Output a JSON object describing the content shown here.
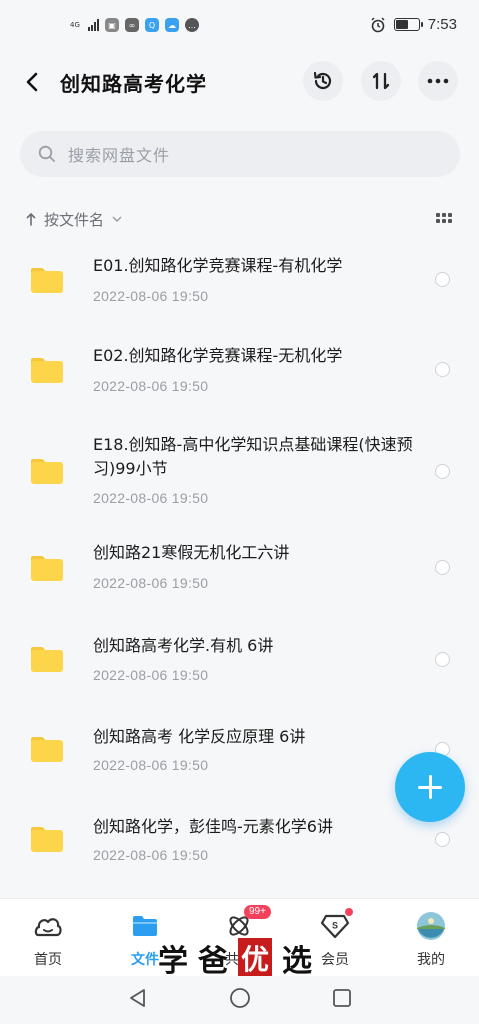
{
  "status_bar": {
    "network": "4G",
    "time": "7:53",
    "battery_level": 0.55
  },
  "header": {
    "title": "创知路高考化学",
    "back_icon": "chevron-left-icon",
    "history_icon": "history-icon",
    "sort_icon": "sort-icon",
    "more_icon": "more-icon"
  },
  "search": {
    "placeholder": "搜索网盘文件"
  },
  "sort": {
    "label": "按文件名"
  },
  "files": [
    {
      "name": "E01.创知路化学竞赛课程-有机化学",
      "date": "2022-08-06  19:50"
    },
    {
      "name": "E02.创知路化学竞赛课程-无机化学",
      "date": "2022-08-06  19:50"
    },
    {
      "name": "E18.创知路-高中化学知识点基础课程(快速预习)99小节",
      "date": "2022-08-06  19:50"
    },
    {
      "name": "创知路21寒假无机化工六讲",
      "date": "2022-08-06  19:50"
    },
    {
      "name": "创知路高考化学.有机   6讲",
      "date": "2022-08-06  19:50"
    },
    {
      "name": "创知路高考 化学反应原理   6讲",
      "date": "2022-08-06  19:50"
    },
    {
      "name": "创知路化学，彭佳鸣-元素化学6讲",
      "date": "2022-08-06  19:50"
    }
  ],
  "bottom_nav": {
    "items": [
      {
        "label": "首页",
        "icon": "home-icon"
      },
      {
        "label": "文件",
        "icon": "folder-icon",
        "active": true
      },
      {
        "label": "共享",
        "icon": "share-icon",
        "badge": "99+"
      },
      {
        "label": "会员",
        "icon": "vip-icon"
      },
      {
        "label": "我的",
        "icon": "avatar-icon"
      }
    ]
  },
  "watermark": {
    "c1": "学",
    "c2": "爸",
    "c3": "优",
    "c4": "选"
  },
  "colors": {
    "accent": "#2b9ef0",
    "fab": "#2db7f2",
    "folder": "#fdd54a",
    "badge": "#f5425c"
  }
}
